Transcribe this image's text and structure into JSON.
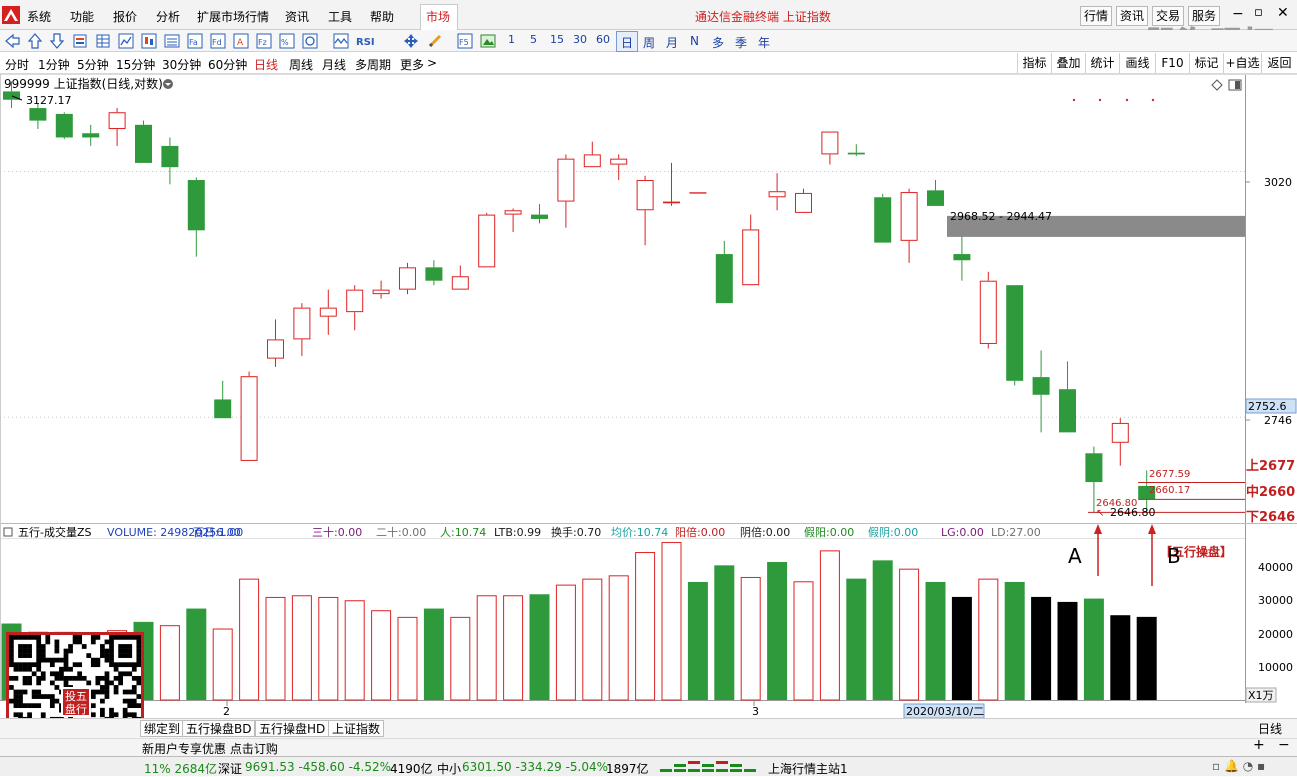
{
  "menu": {
    "items": [
      "系统",
      "功能",
      "报价",
      "分析",
      "扩展市场行情",
      "资讯",
      "工具",
      "帮助"
    ],
    "market_tab": "市场",
    "title": "通达信金融终端 上证指数",
    "right_buttons": [
      "行情",
      "资讯",
      "交易",
      "服务"
    ],
    "watermark": "股海明灯"
  },
  "toolbar": {
    "cycles": [
      "1",
      "5",
      "15",
      "30",
      "60"
    ],
    "periods": [
      "日",
      "周",
      "月",
      "N",
      "多",
      "季",
      "年"
    ]
  },
  "periodbar": {
    "items": [
      "分时",
      "1分钟",
      "5分钟",
      "15分钟",
      "30分钟",
      "60分钟",
      "日线",
      "周线",
      "月线",
      "多周期",
      "更多"
    ],
    "right": [
      "指标",
      "叠加",
      "统计",
      "画线",
      "F10",
      "标记",
      "+自选",
      "返回"
    ]
  },
  "chart": {
    "title": "999999 上证指数(日线,对数)",
    "top_price": "3127.17",
    "y_labels": [
      "3020",
      "2746"
    ],
    "current_price": "2752.6",
    "zone_label": "2968.52 - 2944.47",
    "low_label1": "2646.80",
    "low_label2": "2646.80",
    "label_up": "2677.59",
    "label_mid": "2660.17",
    "right_up": "上2677",
    "right_mid": "中2660",
    "right_down": "下2646"
  },
  "volume": {
    "header": [
      {
        "text": "五行-成交量ZS",
        "color": "#000000"
      },
      {
        "text": "VOLUME: 249820256.00",
        "color": "#1f3fbf"
      },
      {
        "text": "百日:1.00",
        "color": "#1f3fbf"
      },
      {
        "text": "三十:0.00",
        "color": "#7a1a7a"
      },
      {
        "text": "二十:0.00",
        "color": "#707070"
      },
      {
        "text": "人:10.74",
        "color": "#1a8a1a"
      },
      {
        "text": "LTB:0.99",
        "color": "#1a1a1a"
      },
      {
        "text": "换手:0.70",
        "color": "#1a1a1a"
      },
      {
        "text": "均价:10.74",
        "color": "#17a0a0"
      },
      {
        "text": "阳倍:0.00",
        "color": "#c02020"
      },
      {
        "text": "阴倍:0.00",
        "color": "#1a1a1a"
      },
      {
        "text": "假阳:0.00",
        "color": "#1a8a1a"
      },
      {
        "text": "假阴:0.00",
        "color": "#17a0a0"
      },
      {
        "text": "LG:0.00",
        "color": "#7a1a7a"
      },
      {
        "text": "LD:27.00",
        "color": "#707070"
      }
    ],
    "y_labels": [
      "40000",
      "30000",
      "20000",
      "10000"
    ],
    "unit": "X1万",
    "label_a": "A",
    "label_b": "B",
    "badge": "【五行操盘】",
    "x_labels": [
      "2",
      "3"
    ],
    "date_tag": "2020/03/10/二"
  },
  "tabs": {
    "items": [
      "绑定到",
      "五行操盘BD",
      "五行操盘HD",
      "上证指数"
    ],
    "right": "日线"
  },
  "subbar": {
    "text": "新用户专享优惠 点击订购"
  },
  "statusbar": {
    "sh_tail": "11% 2684亿",
    "sz_name": "深证",
    "sz_val": "9691.53 -458.60 -4.52%",
    "sz_amt": "4190亿",
    "zx_name": "中小",
    "zx_val": "6301.50 -334.29 -5.04%",
    "zx_amt": "1897亿",
    "station": "上海行情主站1"
  },
  "qr": {
    "badge": "投五盘行"
  },
  "chart_data": {
    "type": "candlestick",
    "title": "999999 上证指数(日线,对数)",
    "candles": [
      {
        "o": 3115,
        "c": 3105,
        "h": 3127,
        "l": 3095
      },
      {
        "o": 3095,
        "c": 3080,
        "h": 3100,
        "l": 3070
      },
      {
        "o": 3088,
        "c": 3060,
        "h": 3090,
        "l": 3058
      },
      {
        "o": 3065,
        "c": 3060,
        "h": 3075,
        "l": 3050
      },
      {
        "o": 3070,
        "c": 3090,
        "h": 3095,
        "l": 3050
      },
      {
        "o": 3075,
        "c": 3030,
        "h": 3080,
        "l": 3030
      },
      {
        "o": 3050,
        "c": 3025,
        "h": 3060,
        "l": 3005
      },
      {
        "o": 3010,
        "c": 2952,
        "h": 3013,
        "l": 2922
      },
      {
        "o": 2765,
        "c": 2745,
        "h": 2785,
        "l": 2745
      },
      {
        "o": 2700,
        "c": 2790,
        "h": 2795,
        "l": 2700
      },
      {
        "o": 2809,
        "c": 2830,
        "h": 2852,
        "l": 2800
      },
      {
        "o": 2830,
        "c": 2865,
        "h": 2870,
        "l": 2812
      },
      {
        "o": 2855,
        "c": 2865,
        "h": 2885,
        "l": 2835
      },
      {
        "o": 2860,
        "c": 2885,
        "h": 2890,
        "l": 2840
      },
      {
        "o": 2880,
        "c": 2885,
        "h": 2895,
        "l": 2875
      },
      {
        "o": 2885,
        "c": 2910,
        "h": 2915,
        "l": 2880
      },
      {
        "o": 2910,
        "c": 2895,
        "h": 2918,
        "l": 2890
      },
      {
        "o": 2885,
        "c": 2900,
        "h": 2912,
        "l": 2885
      },
      {
        "o": 2910,
        "c": 2970,
        "h": 2972,
        "l": 2910
      },
      {
        "o": 2970,
        "c": 2975,
        "h": 2977,
        "l": 2950
      },
      {
        "o": 2970,
        "c": 2965,
        "h": 2982,
        "l": 2960
      },
      {
        "o": 2985,
        "c": 3035,
        "h": 3040,
        "l": 2955
      },
      {
        "o": 3025,
        "c": 3040,
        "h": 3055,
        "l": 3025
      },
      {
        "o": 3028,
        "c": 3035,
        "h": 3040,
        "l": 3010
      },
      {
        "o": 2975,
        "c": 3010,
        "h": 3015,
        "l": 2935
      },
      {
        "o": 2983,
        "c": 2985,
        "h": 3030,
        "l": 2980
      },
      {
        "o": 2995,
        "c": 2995,
        "h": 2995,
        "l": 2995
      },
      {
        "o": 2925,
        "c": 2870,
        "h": 2940,
        "l": 2870
      },
      {
        "o": 2890,
        "c": 2953,
        "h": 2970,
        "l": 2890
      },
      {
        "o": 2990,
        "c": 2997,
        "h": 3018,
        "l": 2975
      },
      {
        "o": 2972,
        "c": 2995,
        "h": 3000,
        "l": 2973
      },
      {
        "o": 3040,
        "c": 3067,
        "h": 3067,
        "l": 3028
      },
      {
        "o": 3042,
        "c": 3040,
        "h": 3052,
        "l": 3038
      },
      {
        "o": 2990,
        "c": 2938,
        "h": 2994,
        "l": 2938
      },
      {
        "o": 2940,
        "c": 2996,
        "h": 3000,
        "l": 2915
      },
      {
        "o": 2998,
        "c": 2980,
        "h": 3010,
        "l": 2980
      },
      {
        "o": 2925,
        "c": 2918,
        "h": 2945,
        "l": 2895
      },
      {
        "o": 2825,
        "c": 2895,
        "h": 2905,
        "l": 2820
      },
      {
        "o": 2890,
        "c": 2785,
        "h": 2890,
        "l": 2780
      },
      {
        "o": 2789,
        "c": 2770,
        "h": 2818,
        "l": 2730
      },
      {
        "o": 2776,
        "c": 2730,
        "h": 2806,
        "l": 2730
      },
      {
        "o": 2708,
        "c": 2678,
        "h": 2715,
        "l": 2647
      },
      {
        "o": 2719,
        "c": 2740,
        "h": 2745,
        "l": 2695
      },
      {
        "o": 2674,
        "c": 2660,
        "h": 2690,
        "l": 2647
      }
    ],
    "volume": [
      {
        "v": 23000,
        "color": "green"
      },
      {
        "v": 20500,
        "color": "black"
      },
      {
        "v": 20500,
        "color": "green"
      },
      {
        "v": 19500,
        "color": "red"
      },
      {
        "v": 21000,
        "color": "red"
      },
      {
        "v": 23500,
        "color": "green"
      },
      {
        "v": 22500,
        "color": "red"
      },
      {
        "v": 27500,
        "color": "green"
      },
      {
        "v": 21500,
        "color": "red"
      },
      {
        "v": 36500,
        "color": "red"
      },
      {
        "v": 31000,
        "color": "red"
      },
      {
        "v": 31500,
        "color": "red"
      },
      {
        "v": 31000,
        "color": "red"
      },
      {
        "v": 30000,
        "color": "red"
      },
      {
        "v": 27000,
        "color": "red"
      },
      {
        "v": 25000,
        "color": "red"
      },
      {
        "v": 27500,
        "color": "green"
      },
      {
        "v": 25000,
        "color": "red"
      },
      {
        "v": 31500,
        "color": "red"
      },
      {
        "v": 31500,
        "color": "red"
      },
      {
        "v": 31800,
        "color": "green"
      },
      {
        "v": 34700,
        "color": "red"
      },
      {
        "v": 36500,
        "color": "red"
      },
      {
        "v": 37500,
        "color": "red"
      },
      {
        "v": 44500,
        "color": "red"
      },
      {
        "v": 47500,
        "color": "red"
      },
      {
        "v": 35500,
        "color": "green"
      },
      {
        "v": 40500,
        "color": "green"
      },
      {
        "v": 37000,
        "color": "red"
      },
      {
        "v": 41500,
        "color": "green"
      },
      {
        "v": 35700,
        "color": "red"
      },
      {
        "v": 45000,
        "color": "red"
      },
      {
        "v": 36500,
        "color": "green"
      },
      {
        "v": 42000,
        "color": "green"
      },
      {
        "v": 39500,
        "color": "red"
      },
      {
        "v": 35500,
        "color": "green"
      },
      {
        "v": 31000,
        "color": "black"
      },
      {
        "v": 36500,
        "color": "red"
      },
      {
        "v": 35500,
        "color": "green"
      },
      {
        "v": 31000,
        "color": "black"
      },
      {
        "v": 29500,
        "color": "black"
      },
      {
        "v": 30500,
        "color": "green"
      },
      {
        "v": 25500,
        "color": "black"
      },
      {
        "v": 25000,
        "color": "black"
      }
    ],
    "resistance_zone": [
      2944.47,
      2968.52
    ],
    "hlines": {
      "up": 2677.59,
      "mid": 2660.17,
      "down": 2646.8
    },
    "ylim": [
      2640,
      3130
    ],
    "vol_ylim": [
      0,
      50000
    ],
    "colors": {
      "up": "#dd2222",
      "down": "#2f9a3b",
      "black": "#000000"
    }
  }
}
